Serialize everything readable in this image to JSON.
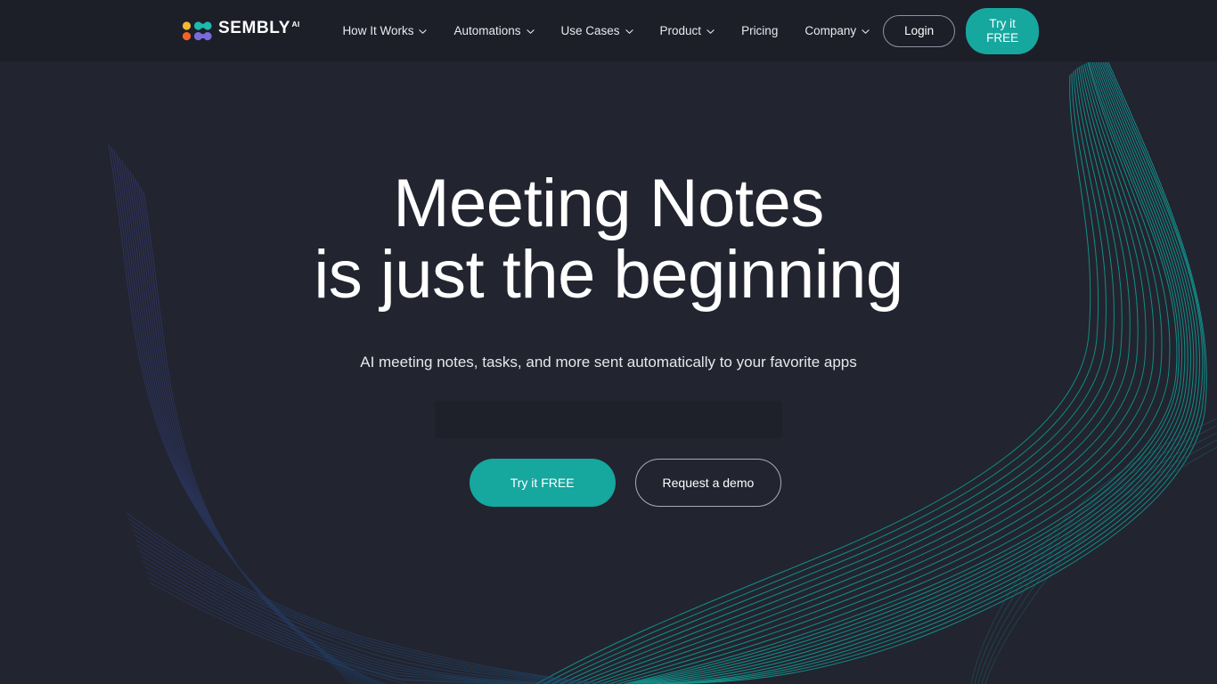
{
  "brand": {
    "name": "SEMBLY",
    "superscript": "AI",
    "logo_colors": {
      "yellow": "#f5b731",
      "teal": "#1fb9ad",
      "orange": "#f26322",
      "purple": "#7b6ad8"
    },
    "accent": "#16a79f"
  },
  "header": {
    "nav": [
      {
        "label": "How It Works",
        "icon": "chevron-down-icon",
        "has_dropdown": true
      },
      {
        "label": "Automations",
        "icon": "chevron-down-icon",
        "has_dropdown": true
      },
      {
        "label": "Use Cases",
        "icon": "chevron-down-icon",
        "has_dropdown": true
      },
      {
        "label": "Product",
        "icon": "chevron-down-icon",
        "has_dropdown": true
      },
      {
        "label": "Pricing",
        "icon": "",
        "has_dropdown": false
      },
      {
        "label": "Company",
        "icon": "chevron-down-icon",
        "has_dropdown": true
      }
    ],
    "login_label": "Login",
    "try_free_label": "Try it FREE"
  },
  "hero": {
    "title_line1": "Meeting Notes",
    "title_line2": "is just the beginning",
    "subtitle": "AI meeting notes, tasks, and more sent automatically to your favorite apps",
    "primary_cta": "Try it FREE",
    "secondary_cta": "Request a demo"
  },
  "theme": {
    "background": "#22242f",
    "header_background": "#1c1e28",
    "text_primary": "#ffffff",
    "text_secondary": "#e6e8ed",
    "accent_teal": "#16a79f",
    "deco_teal": "#1a7f86",
    "deco_indigo": "#3a4180"
  }
}
